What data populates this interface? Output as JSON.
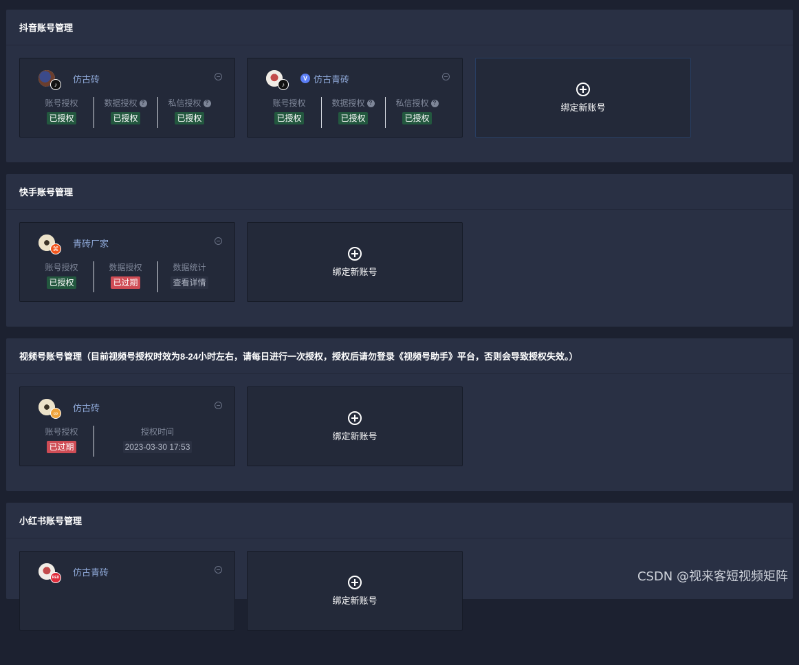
{
  "sections": [
    {
      "title": "抖音账号管理",
      "accounts": [
        {
          "name": "仿古砖",
          "verified": false,
          "stats": [
            {
              "label": "账号授权",
              "status": "已授权"
            },
            {
              "label": "数据授权",
              "status": "已授权"
            },
            {
              "label": "私信授权",
              "status": "已授权"
            }
          ]
        },
        {
          "name": "仿古青砖",
          "verified": true,
          "stats": [
            {
              "label": "账号授权",
              "status": "已授权"
            },
            {
              "label": "数据授权",
              "status": "已授权"
            },
            {
              "label": "私信授权",
              "status": "已授权"
            }
          ]
        }
      ],
      "add_label": "绑定新账号"
    },
    {
      "title": "快手账号管理",
      "accounts": [
        {
          "name": "青砖厂家",
          "stats": [
            {
              "label": "账号授权",
              "status": "已授权"
            },
            {
              "label": "数据授权",
              "status": "已过期"
            },
            {
              "label": "数据统计",
              "status": "查看详情"
            }
          ]
        }
      ],
      "add_label": "绑定新账号"
    },
    {
      "title": "视频号账号管理（目前视频号授权时效为8-24小时左右，请每日进行一次授权，授权后请勿登录《视频号助手》平台，否则会导致授权失效。）",
      "accounts": [
        {
          "name": "仿古砖",
          "stats": [
            {
              "label": "账号授权",
              "status": "已过期"
            },
            {
              "label": "授权时间",
              "status": "2023-03-30 17:53"
            }
          ]
        }
      ],
      "add_label": "绑定新账号"
    },
    {
      "title": "小红书账号管理",
      "accounts": [
        {
          "name": "仿古青砖"
        }
      ],
      "add_label": "绑定新账号"
    }
  ],
  "help_glyph": "?",
  "verified_glyph": "V",
  "badge_glyphs": {
    "douyin": "♪",
    "kuaishou": "⌘",
    "shipinhao": "∞",
    "xhs": "RED"
  },
  "watermark": "CSDN @视来客短视频矩阵",
  "colors": {
    "authorized": "#23583f",
    "expired": "#cf4c55",
    "name": "#8fa9d9"
  }
}
